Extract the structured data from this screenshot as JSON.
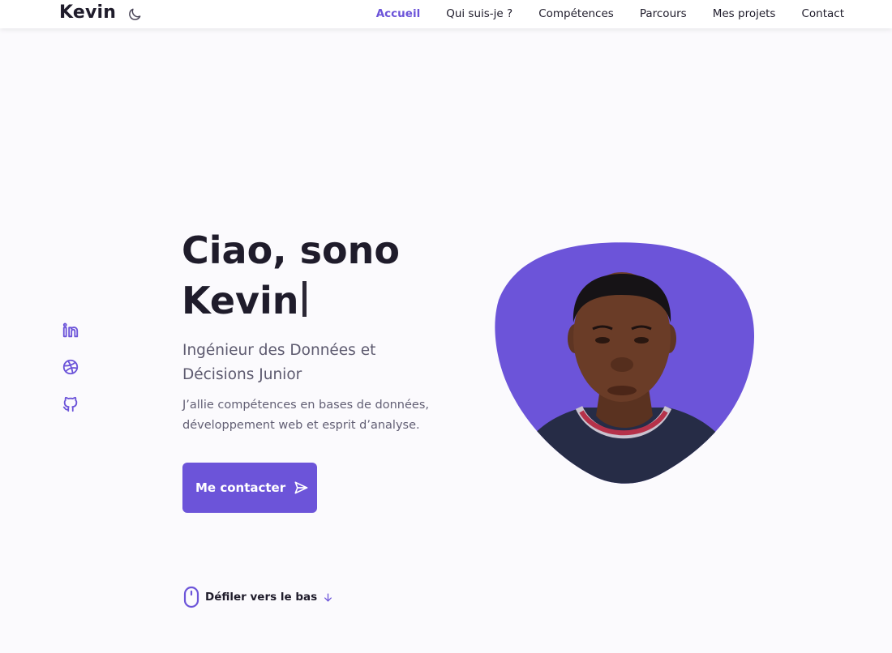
{
  "brand": {
    "name": "Kevin"
  },
  "theme_toggle": {
    "icon": "moon-icon"
  },
  "nav": {
    "items": [
      {
        "label": "Accueil",
        "active": true
      },
      {
        "label": "Qui suis-je ?",
        "active": false
      },
      {
        "label": "Compétences",
        "active": false
      },
      {
        "label": "Parcours",
        "active": false
      },
      {
        "label": "Mes projets",
        "active": false
      },
      {
        "label": "Contact",
        "active": false
      }
    ]
  },
  "socials": [
    {
      "icon": "linkedin-icon"
    },
    {
      "icon": "dribbble-icon"
    },
    {
      "icon": "github-icon"
    }
  ],
  "hero": {
    "line1": "Ciao, sono",
    "line2": "Kevin",
    "subtitle": "Ingénieur des Données et Décisions Junior",
    "description": "J’allie compétences en bases de données, développement web et esprit d’analyse.",
    "cta_label": "Me contacter",
    "cta_icon": "send-icon"
  },
  "scroll_down": {
    "label": "Défiler vers le bas",
    "icon": "mouse-icon",
    "arrow_icon": "arrow-down-icon"
  },
  "colors": {
    "accent": "#6c54d9",
    "text": "#1f1c2b",
    "muted": "#5d5a6f",
    "background": "#fbfafd"
  }
}
